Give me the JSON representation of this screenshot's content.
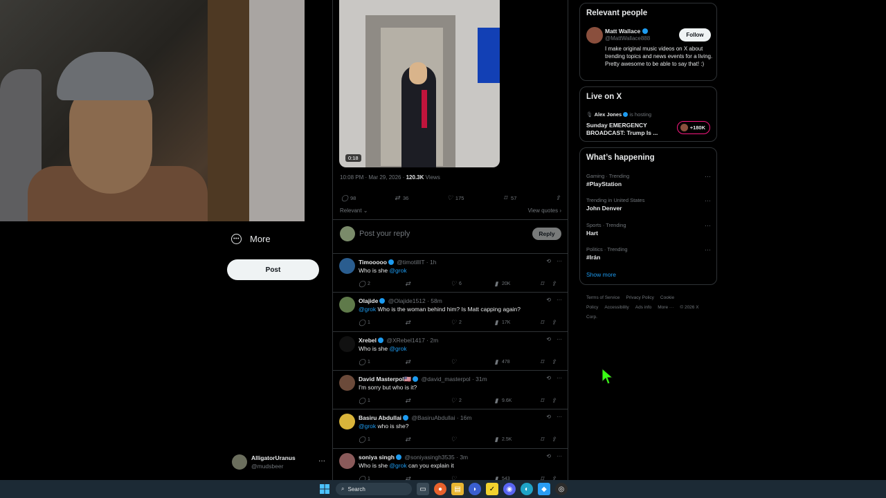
{
  "left_nav": {
    "more_label": "More",
    "post_label": "Post",
    "account": {
      "display_name": "AlligatorUranus",
      "handle": "@mudsbeer",
      "menu": "···"
    }
  },
  "post": {
    "video_duration": "0:18",
    "timestamp": "10:08 PM · Mar 29, 2026 · ",
    "views_count": "120.3K",
    "views_label": " Views",
    "stats": {
      "replies": "98",
      "reposts": "36",
      "likes": "175",
      "bookmarks": "57"
    },
    "sort_label": "Relevant ⌄",
    "view_quotes": "View quotes ›",
    "reply_placeholder": "Post your reply",
    "reply_button": "Reply"
  },
  "replies": [
    {
      "name": "Timooooo",
      "meta": "@timotillIT · 1h",
      "pre": "Who is she ",
      "mention": "@grok",
      "post": "",
      "replies": "2",
      "reposts": "",
      "likes": "6",
      "views": "20K",
      "avatar_color": "#2a5d8f"
    },
    {
      "name": "Olajide",
      "meta": "@Olajide1512 · 58m",
      "pre": "",
      "mention": "@grok",
      "post": " Who is the woman behind him? Is Matt capping again?",
      "replies": "1",
      "reposts": "",
      "likes": "2",
      "views": "17K",
      "avatar_color": "#5f7a4a"
    },
    {
      "name": "Xrebel",
      "meta": "@XRebel1417 · 2m",
      "pre": "Who is she ",
      "mention": "@grok",
      "post": "",
      "replies": "1",
      "reposts": "",
      "likes": "",
      "views": "478",
      "avatar_color": "#111111"
    },
    {
      "name": "David Masterpol🇺🇸",
      "meta": "@david_masterpol · 31m",
      "pre": "I'm sorry but who is it?",
      "mention": "",
      "post": "",
      "replies": "1",
      "reposts": "",
      "likes": "2",
      "views": "9.6K",
      "avatar_color": "#6b4a3a"
    },
    {
      "name": "Basiru Abdullai",
      "meta": "@BasiruAbdullai · 16m",
      "pre": "",
      "mention": "@grok",
      "post": " who is she?",
      "replies": "1",
      "reposts": "",
      "likes": "",
      "views": "2.5K",
      "avatar_color": "#d9b43a"
    },
    {
      "name": "soniya singh",
      "meta": "@soniyasingh3535 · 3m",
      "pre": "Who is she ",
      "mention": "@grok",
      "post": " can you explain it",
      "replies": "1",
      "reposts": "",
      "likes": "",
      "views": "543",
      "avatar_color": "#8a5a5a"
    }
  ],
  "sidebar": {
    "relevant_title": "Relevant people",
    "person": {
      "name": "Matt Wallace",
      "handle": "@MattWallace888",
      "follow": "Follow",
      "bio": "I make original music videos on X about trending topics and news events for a living. Pretty awesome to be able to say that! :)"
    },
    "live_title": "Live on X",
    "live": {
      "host": "Alex Jones",
      "hosting": " is hosting",
      "title": "Sunday EMERGENCY BROADCAST: Trump Is ...",
      "count": "+180K"
    },
    "happening_title": "What’s happening",
    "trends": [
      {
        "category": "Gaming · Trending",
        "name": "#PlayStation"
      },
      {
        "category": "Trending in United States",
        "name": "John Denver"
      },
      {
        "category": "Sports · Trending",
        "name": "Hart"
      },
      {
        "category": "Politics · Trending",
        "name": "#Irán"
      }
    ],
    "show_more": "Show more",
    "footer": [
      "Terms of Service",
      "Privacy Policy",
      "Cookie Policy",
      "Accessibility",
      "Ads info",
      "More ···",
      "© 2026 X Corp."
    ]
  },
  "taskbar": {
    "search_label": "Search"
  },
  "colors": {
    "accent": "#1d9bf0",
    "live_ring": "#f91880",
    "cursor": "#39ff14"
  }
}
